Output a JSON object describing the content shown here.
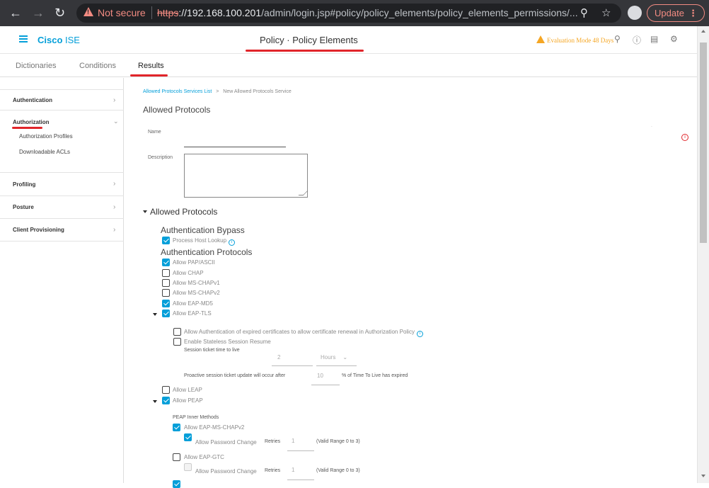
{
  "browser": {
    "not_secure": "Not secure",
    "url_proto": "https",
    "url_host": "://192.168.100.201",
    "url_path": "/admin/login.jsp#policy/policy_elements/policy_elements_permissions/...",
    "update_label": "Update"
  },
  "header": {
    "brand_main": "Cisco",
    "brand_product": " ISE",
    "title": "Policy · Policy Elements",
    "eval_mode": "Evaluation Mode 48 Days"
  },
  "tabs": [
    "Dictionaries",
    "Conditions",
    "Results"
  ],
  "sidebar": {
    "items": [
      "Authentication",
      "Authorization",
      "Profiling",
      "Posture",
      "Client Provisioning"
    ],
    "authorization_sub": [
      "Authorization Profiles",
      "Downloadable ACLs"
    ]
  },
  "main": {
    "breadcrumb_link": "Allowed Protocols Services List",
    "breadcrumb_sep": ">",
    "breadcrumb_current": "New Allowed Protocols Service",
    "heading": "Allowed Protocols",
    "name_label": "Name",
    "description_label": "Description",
    "section_heading": "Allowed Protocols",
    "auth_bypass_heading": "Authentication Bypass",
    "process_host_lookup": "Process Host Lookup",
    "auth_protocols_heading": "Authentication Protocols",
    "protocols": [
      {
        "label": "Allow PAP/ASCII",
        "checked": true
      },
      {
        "label": "Allow CHAP",
        "checked": false
      },
      {
        "label": "Allow MS-CHAPv1",
        "checked": false
      },
      {
        "label": "Allow MS-CHAPv2",
        "checked": false
      },
      {
        "label": "Allow EAP-MD5",
        "checked": true
      },
      {
        "label": "Allow EAP-TLS",
        "checked": true
      }
    ],
    "eap_tls": {
      "expired_certs": "Allow Authentication of expired certificates to allow certificate renewal in Authorization Policy",
      "stateless_resume": "Enable Stateless Session Resume",
      "ticket_ttl_label": "Session ticket time to live",
      "ticket_ttl_value": "2",
      "ticket_ttl_unit": "Hours",
      "proactive_prefix": "Proactive session ticket update will occur after",
      "proactive_value": "10",
      "proactive_suffix": "% of Time To Live has expired"
    },
    "allow_leap": "Allow LEAP",
    "allow_peap": "Allow PEAP",
    "peap": {
      "inner_methods_label": "PEAP Inner Methods",
      "ms_chapv2": "Allow EAP-MS-CHAPv2",
      "pwd_change": "Allow Password Change",
      "retries_label": "Retries",
      "retries_value": "1",
      "valid_range": "(Valid Range 0 to 3)",
      "gtc": "Allow EAP-GTC"
    }
  }
}
